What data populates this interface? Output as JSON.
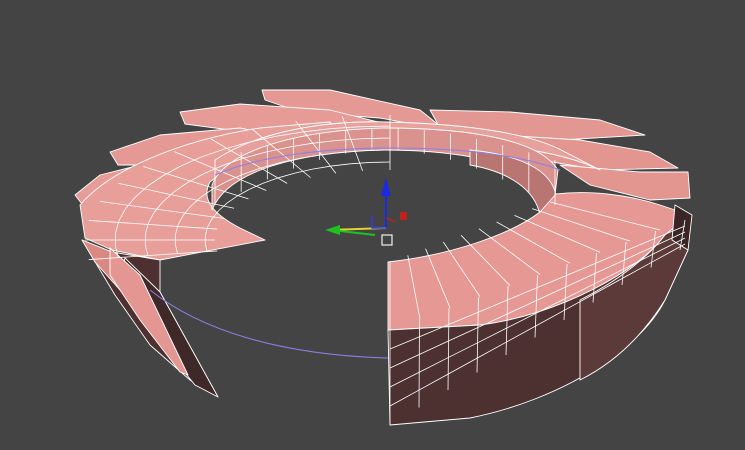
{
  "viewport": {
    "name": "3d-perspective-viewport",
    "background": "#444444"
  },
  "mesh": {
    "kind": "twisted-blade-ring",
    "face_top_color": "#e89d98",
    "face_top_shade": "#d2857f",
    "face_side_color": "#4e3232",
    "face_side_light": "#6a4444",
    "wire_color": "#ffffff",
    "blade_count": 12,
    "ring_cut_open": true
  },
  "guide_circle": {
    "color": "#8f7fe6"
  },
  "gizmo": {
    "x_color": "#e1d42c",
    "y_color": "#20c020",
    "z_color": "#1a2ae0",
    "pivot_color": "#c21f1f",
    "icons": [
      "transform-gizmo-icon",
      "pivot-box-icon"
    ]
  }
}
